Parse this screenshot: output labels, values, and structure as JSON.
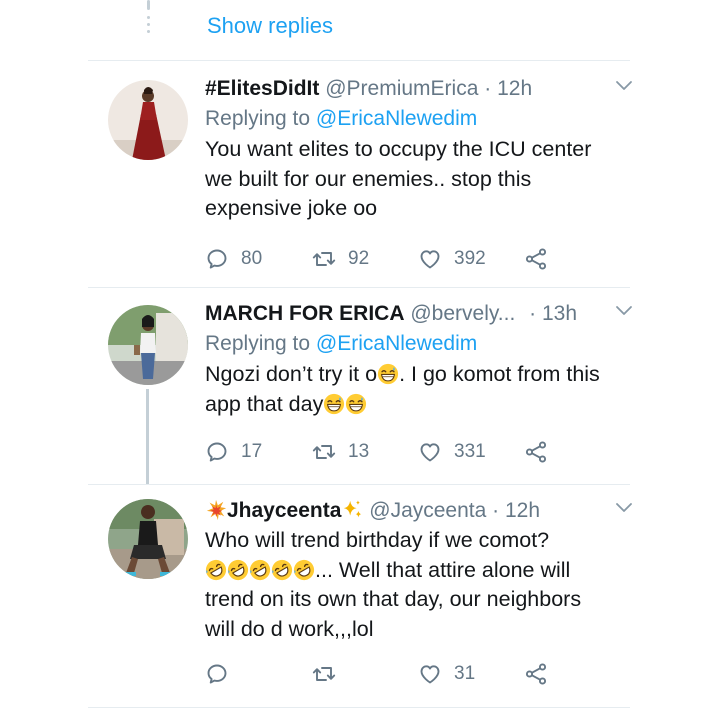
{
  "thread": {
    "show_replies": "Show replies"
  },
  "tweets": [
    {
      "display_name": "#ElitesDidIt",
      "handle": "@PremiumErica",
      "separator": "·",
      "time": "12h",
      "replying_label": "Replying to",
      "replying_to": "@EricaNlewedim",
      "body": "You want elites to occupy the ICU center we built for our enemies.. stop this expensive joke oo",
      "replies": "80",
      "retweets": "92",
      "likes": "392"
    },
    {
      "display_name": "MARCH FOR ERICA",
      "handle": "@bervely...",
      "separator": "·",
      "time": "13h",
      "replying_label": "Replying to",
      "replying_to": "@EricaNlewedim",
      "body_part1": "Ngozi don’t try it o",
      "body_part2": ". I go komot from this app that day",
      "replies": "17",
      "retweets": "13",
      "likes": "331"
    },
    {
      "display_name": "Jhayceenta",
      "handle": "@Jayceenta",
      "separator": "·",
      "time": "12h",
      "body_part1": "Who will trend birthday if we comot?",
      "body_part2": "... Well that attire alone will trend on its own that day, our neighbors will do d work,,,lol",
      "likes": "31"
    }
  ],
  "colors": {
    "accent": "#1da1f2",
    "secondary_text": "#657786",
    "primary_text": "#14171a",
    "divider": "#e6ecf0"
  },
  "icons": [
    "reply-icon",
    "retweet-icon",
    "like-icon",
    "share-icon",
    "chevron-down-icon",
    "grinning-sweat-emoji",
    "rofl-emoji",
    "explosion-emoji",
    "sparkles-emoji"
  ]
}
